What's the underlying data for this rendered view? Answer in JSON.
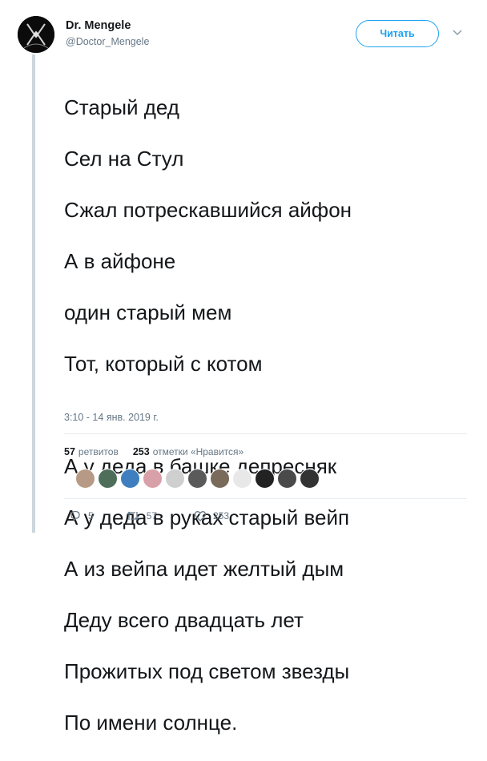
{
  "author": {
    "name": "Dr. Mengele",
    "handle": "@Doctor_Mengele"
  },
  "follow_label": "Читать",
  "tweet": {
    "lines": [
      "Старый дед",
      "Сел на Стул",
      "Сжал потрескавшийся айфон",
      "А в айфоне",
      "один старый мем",
      "Тот, который с котом",
      "",
      "А у деда в башке депресняк",
      "А у деда в руках старый вейп",
      "А из вейпа идет желтый дым",
      "Деду всего двадцать лет",
      "Прожитых под светом звезды",
      "По имени солнце."
    ],
    "timestamp": "3:10 - 14 янв. 2019 г."
  },
  "stats": {
    "retweets_count": "57",
    "retweets_label": "ретвитов",
    "likes_count": "253",
    "likes_label": "отметки «Нравится»"
  },
  "liker_avatar_colors": [
    "#b79a86",
    "#4e6e5a",
    "#3f7fbf",
    "#d8a0a8",
    "#cfcfcf",
    "#5a5a5a",
    "#7a6a5a",
    "#e8e8e8",
    "#222222",
    "#4a4a4a",
    "#333333"
  ],
  "actions": {
    "reply_count": "5",
    "retweet_count": "57",
    "like_count": "253"
  },
  "colors": {
    "accent": "#1da1f2",
    "secondary_text": "#657786",
    "thread_line": "#ccd6dd"
  },
  "icons": {
    "caret": "chevron-down-icon",
    "reply": "reply-icon",
    "retweet": "retweet-icon",
    "like": "heart-icon"
  }
}
